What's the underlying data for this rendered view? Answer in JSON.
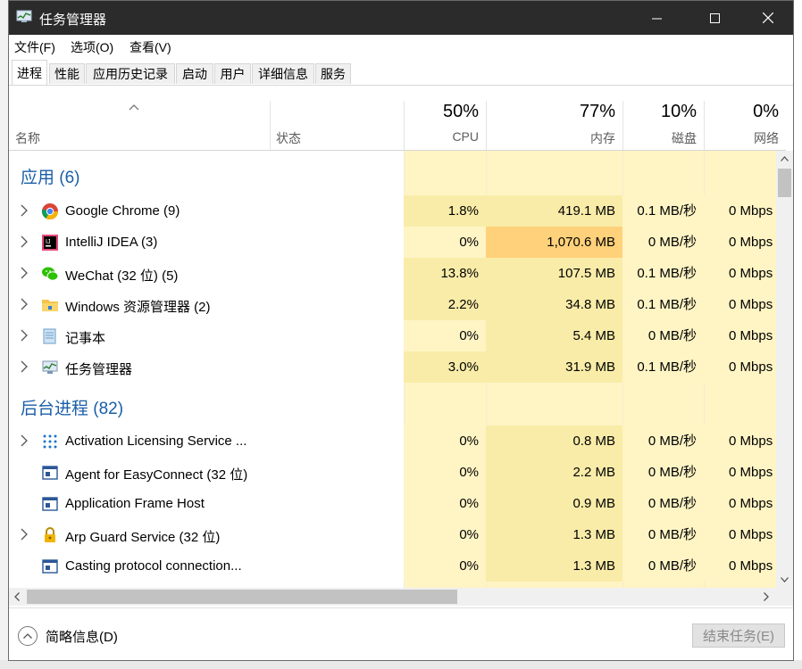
{
  "window": {
    "title": "任务管理器"
  },
  "menu": [
    "文件(F)",
    "选项(O)",
    "查看(V)"
  ],
  "tabs": [
    "进程",
    "性能",
    "应用历史记录",
    "启动",
    "用户",
    "详细信息",
    "服务"
  ],
  "active_tab": "进程",
  "columns": {
    "name": "名称",
    "status": "状态",
    "cpu": {
      "pct": "50%",
      "label": "CPU"
    },
    "memory": {
      "pct": "77%",
      "label": "内存"
    },
    "disk": {
      "pct": "10%",
      "label": "磁盘"
    },
    "network": {
      "pct": "0%",
      "label": "网络"
    }
  },
  "groups": [
    {
      "title": "应用 (6)",
      "rows": [
        {
          "icon": "chrome-icon",
          "name": "Google Chrome (9)",
          "cpu": "1.8%",
          "memory": "419.1 MB",
          "disk": "0.1 MB/秒",
          "network": "0 Mbps",
          "expandable": true
        },
        {
          "icon": "intellij-icon",
          "name": "IntelliJ IDEA (3)",
          "cpu": "0%",
          "memory": "1,070.6 MB",
          "disk": "0 MB/秒",
          "network": "0 Mbps",
          "expandable": true
        },
        {
          "icon": "wechat-icon",
          "name": "WeChat (32 位) (5)",
          "cpu": "13.8%",
          "memory": "107.5 MB",
          "disk": "0.1 MB/秒",
          "network": "0 Mbps",
          "expandable": true
        },
        {
          "icon": "folder-icon",
          "name": "Windows 资源管理器 (2)",
          "cpu": "2.2%",
          "memory": "34.8 MB",
          "disk": "0.1 MB/秒",
          "network": "0 Mbps",
          "expandable": true
        },
        {
          "icon": "notepad-icon",
          "name": "记事本",
          "cpu": "0%",
          "memory": "5.4 MB",
          "disk": "0 MB/秒",
          "network": "0 Mbps",
          "expandable": true
        },
        {
          "icon": "taskmgr-icon",
          "name": "任务管理器",
          "cpu": "3.0%",
          "memory": "31.9 MB",
          "disk": "0.1 MB/秒",
          "network": "0 Mbps",
          "expandable": true
        }
      ]
    },
    {
      "title": "后台进程 (82)",
      "rows": [
        {
          "icon": "dots-icon",
          "name": "Activation Licensing Service ...",
          "cpu": "0%",
          "memory": "0.8 MB",
          "disk": "0 MB/秒",
          "network": "0 Mbps",
          "expandable": true
        },
        {
          "icon": "window-icon",
          "name": "Agent for EasyConnect (32 位)",
          "cpu": "0%",
          "memory": "2.2 MB",
          "disk": "0 MB/秒",
          "network": "0 Mbps",
          "expandable": false
        },
        {
          "icon": "window-icon",
          "name": "Application Frame Host",
          "cpu": "0%",
          "memory": "0.9 MB",
          "disk": "0 MB/秒",
          "network": "0 Mbps",
          "expandable": false
        },
        {
          "icon": "lock-icon",
          "name": "Arp Guard Service (32 位)",
          "cpu": "0%",
          "memory": "1.3 MB",
          "disk": "0 MB/秒",
          "network": "0 Mbps",
          "expandable": true
        },
        {
          "icon": "window-icon",
          "name": "Casting protocol connection...",
          "cpu": "0%",
          "memory": "1.3 MB",
          "disk": "0 MB/秒",
          "network": "0 Mbps",
          "expandable": false
        }
      ]
    }
  ],
  "footer": {
    "fewer_details": "简略信息(D)",
    "end_task": "结束任务(E)"
  },
  "colors": {
    "heat_low": "#fff4c4",
    "heat_mid": "#f9eca8",
    "heat_high": "#ffd17a",
    "group_title": "#1a5ea8",
    "titlebar": "#2b2b2b"
  }
}
